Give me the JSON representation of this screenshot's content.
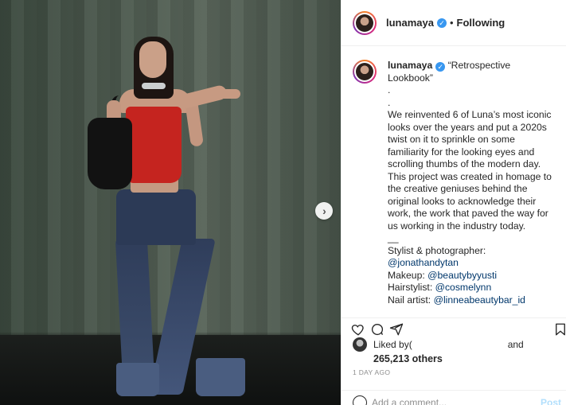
{
  "photo": {
    "next_icon": "chevron-right-icon",
    "next_glyph": "›"
  },
  "header": {
    "username": "lunamaya",
    "verified_glyph": "✓",
    "separator": "•",
    "follow_status": "Following"
  },
  "caption": {
    "username": "lunamaya",
    "verified_glyph": "✓",
    "title": " “Retrospective Lookbook”",
    "dots": [
      ".",
      "."
    ],
    "body": "We reinvented 6 of Luna’s most iconic looks over the years and put a 2020s twist on it to sprinkle on some familiarity for the looking eyes and scrolling thumbs of the modern day. This project was created in homage to the creative geniuses behind the original looks to acknowledge their work, the work that paved the way for us working in the industry today.",
    "underscore": "__",
    "credits": [
      {
        "label": "Stylist & photographer:",
        "handle": ""
      },
      {
        "label": "",
        "handle": "@jonathandytan"
      },
      {
        "label": "Makeup: ",
        "handle": "@beautybyyusti"
      },
      {
        "label": "Hairstylist: ",
        "handle": "@cosmelynn"
      },
      {
        "label": "Nail artist: ",
        "handle": "@linneabeautybar_id"
      }
    ]
  },
  "actions": {
    "like_icon": "heart-icon",
    "comment_icon": "comment-icon",
    "share_icon": "share-icon",
    "save_icon": "bookmark-icon"
  },
  "likes": {
    "liked_by": "Liked by ",
    "liked_by_user": "(",
    "and": "and",
    "count": "265,213 others"
  },
  "date": "1 DAY AGO",
  "comment": {
    "placeholder": "Add a comment...",
    "post_label": "Post",
    "emoji_icon": "smiley-icon"
  },
  "colors": {
    "link": "#00376b",
    "verified": "#3897f0",
    "muted": "#8e8e8e",
    "top_red": "#c5241f"
  }
}
